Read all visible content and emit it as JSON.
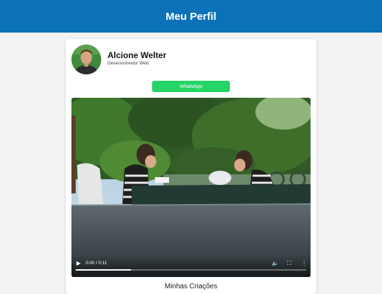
{
  "header": {
    "title": "Meu Perfil"
  },
  "profile": {
    "name": "Alcione Welter",
    "role": "Desenvolvedor Web",
    "avatar_icon": "person-photo"
  },
  "whatsapp": {
    "label": "WhatsApp",
    "color": "#25d366"
  },
  "video": {
    "time": "0:00 / 0:11",
    "progress": 0.24,
    "play_icon": "play-icon",
    "volume_icon": "volume-icon",
    "fullscreen_icon": "fullscreen-icon",
    "menu_icon": "more-options-icon"
  },
  "section": {
    "title": "Minhas Criações"
  },
  "colors": {
    "header": "#0b72b8",
    "background": "#f2f2f2"
  }
}
